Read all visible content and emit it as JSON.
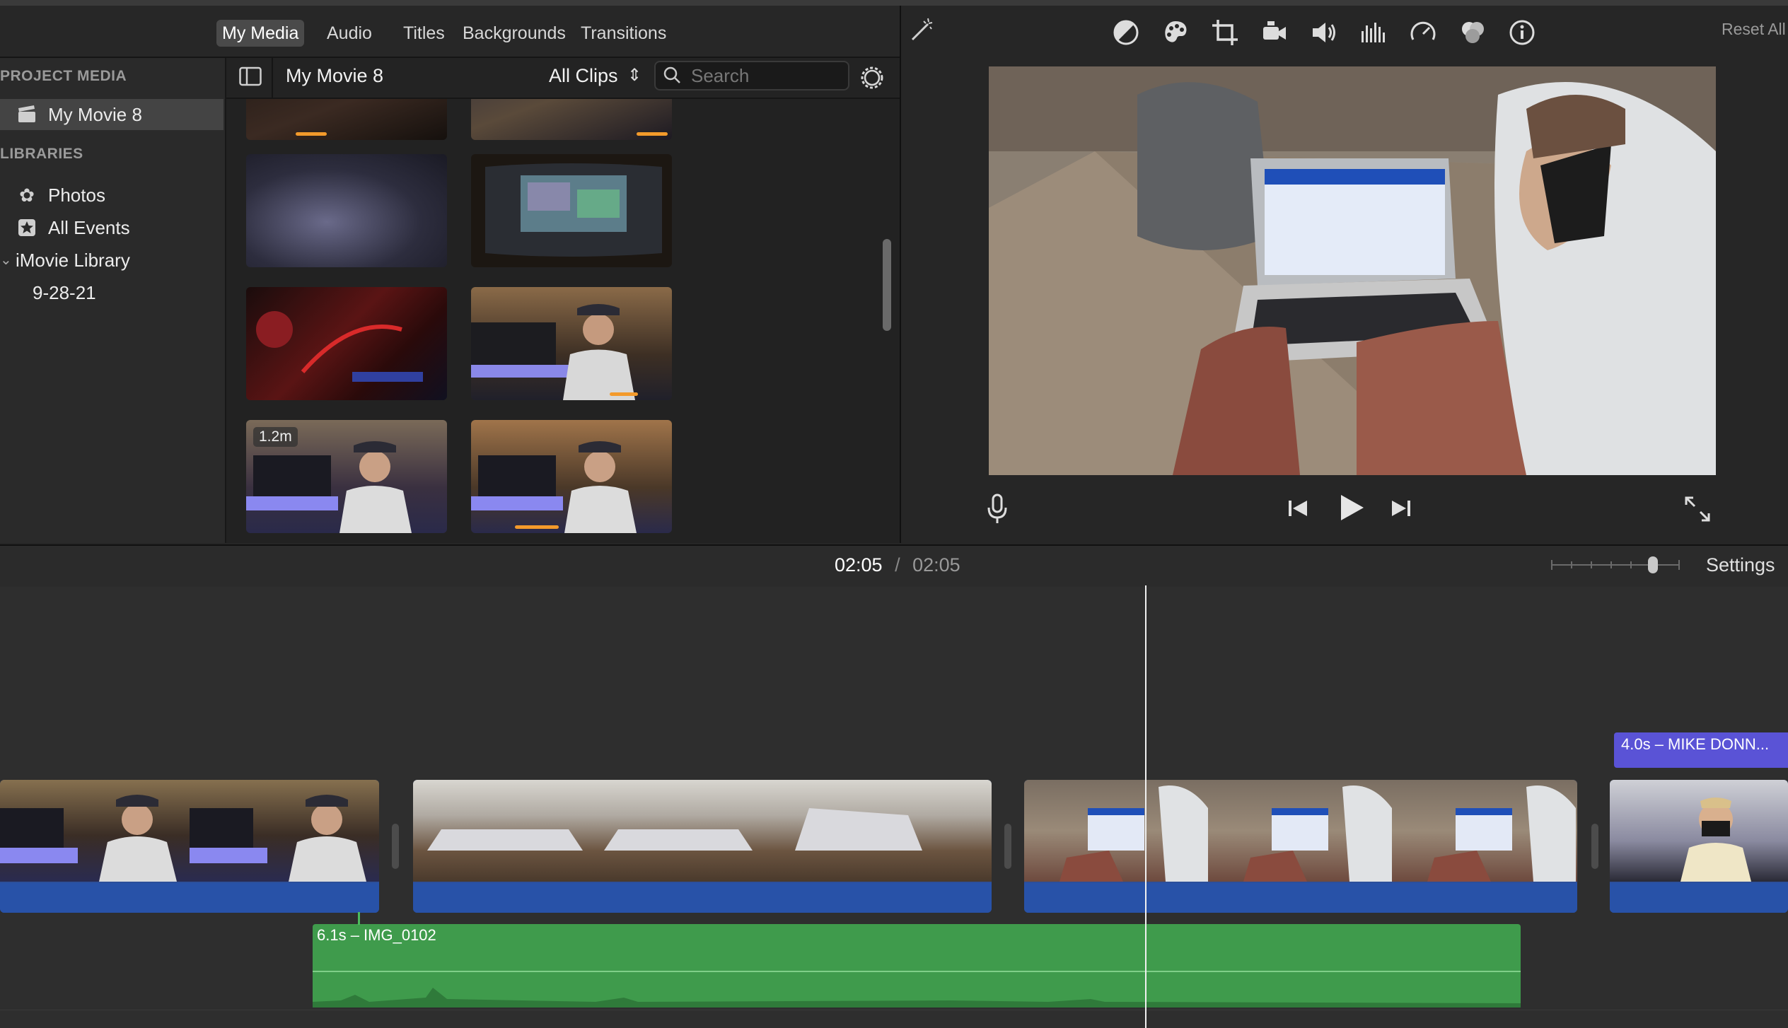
{
  "top_tabs": [
    "My Media",
    "Audio",
    "Titles",
    "Backgrounds",
    "Transitions"
  ],
  "sidebar": {
    "project_header": "PROJECT MEDIA",
    "project_item": "My Movie 8",
    "libraries_header": "LIBRARIES",
    "libraries": [
      "Photos",
      "All Events",
      "iMovie Library",
      "9-28-21"
    ]
  },
  "browser": {
    "title": "My Movie 8",
    "filter": "All Clips",
    "search_placeholder": "Search",
    "duration_badge": "1.2m"
  },
  "viewer": {
    "reset_all": "Reset All",
    "tool_icons": [
      "color-balance-icon",
      "color-correction-icon",
      "crop-icon",
      "stabilization-icon",
      "volume-icon",
      "equalizer-icon",
      "speed-icon",
      "noise-reduction-icon",
      "clip-info-icon"
    ]
  },
  "timeline": {
    "current_time": "02:05",
    "separator": "/",
    "total_time": "02:05",
    "settings_label": "Settings",
    "audio_clip_label": "6.1s – IMG_0102",
    "title_clip_label": "4.0s – MIKE DONN..."
  },
  "colors": {
    "video_clip": "#2c4f9a",
    "audio_clip": "#3f9b4c",
    "title_clip": "#5a53d6",
    "accent_bar": "#f39a2b"
  }
}
